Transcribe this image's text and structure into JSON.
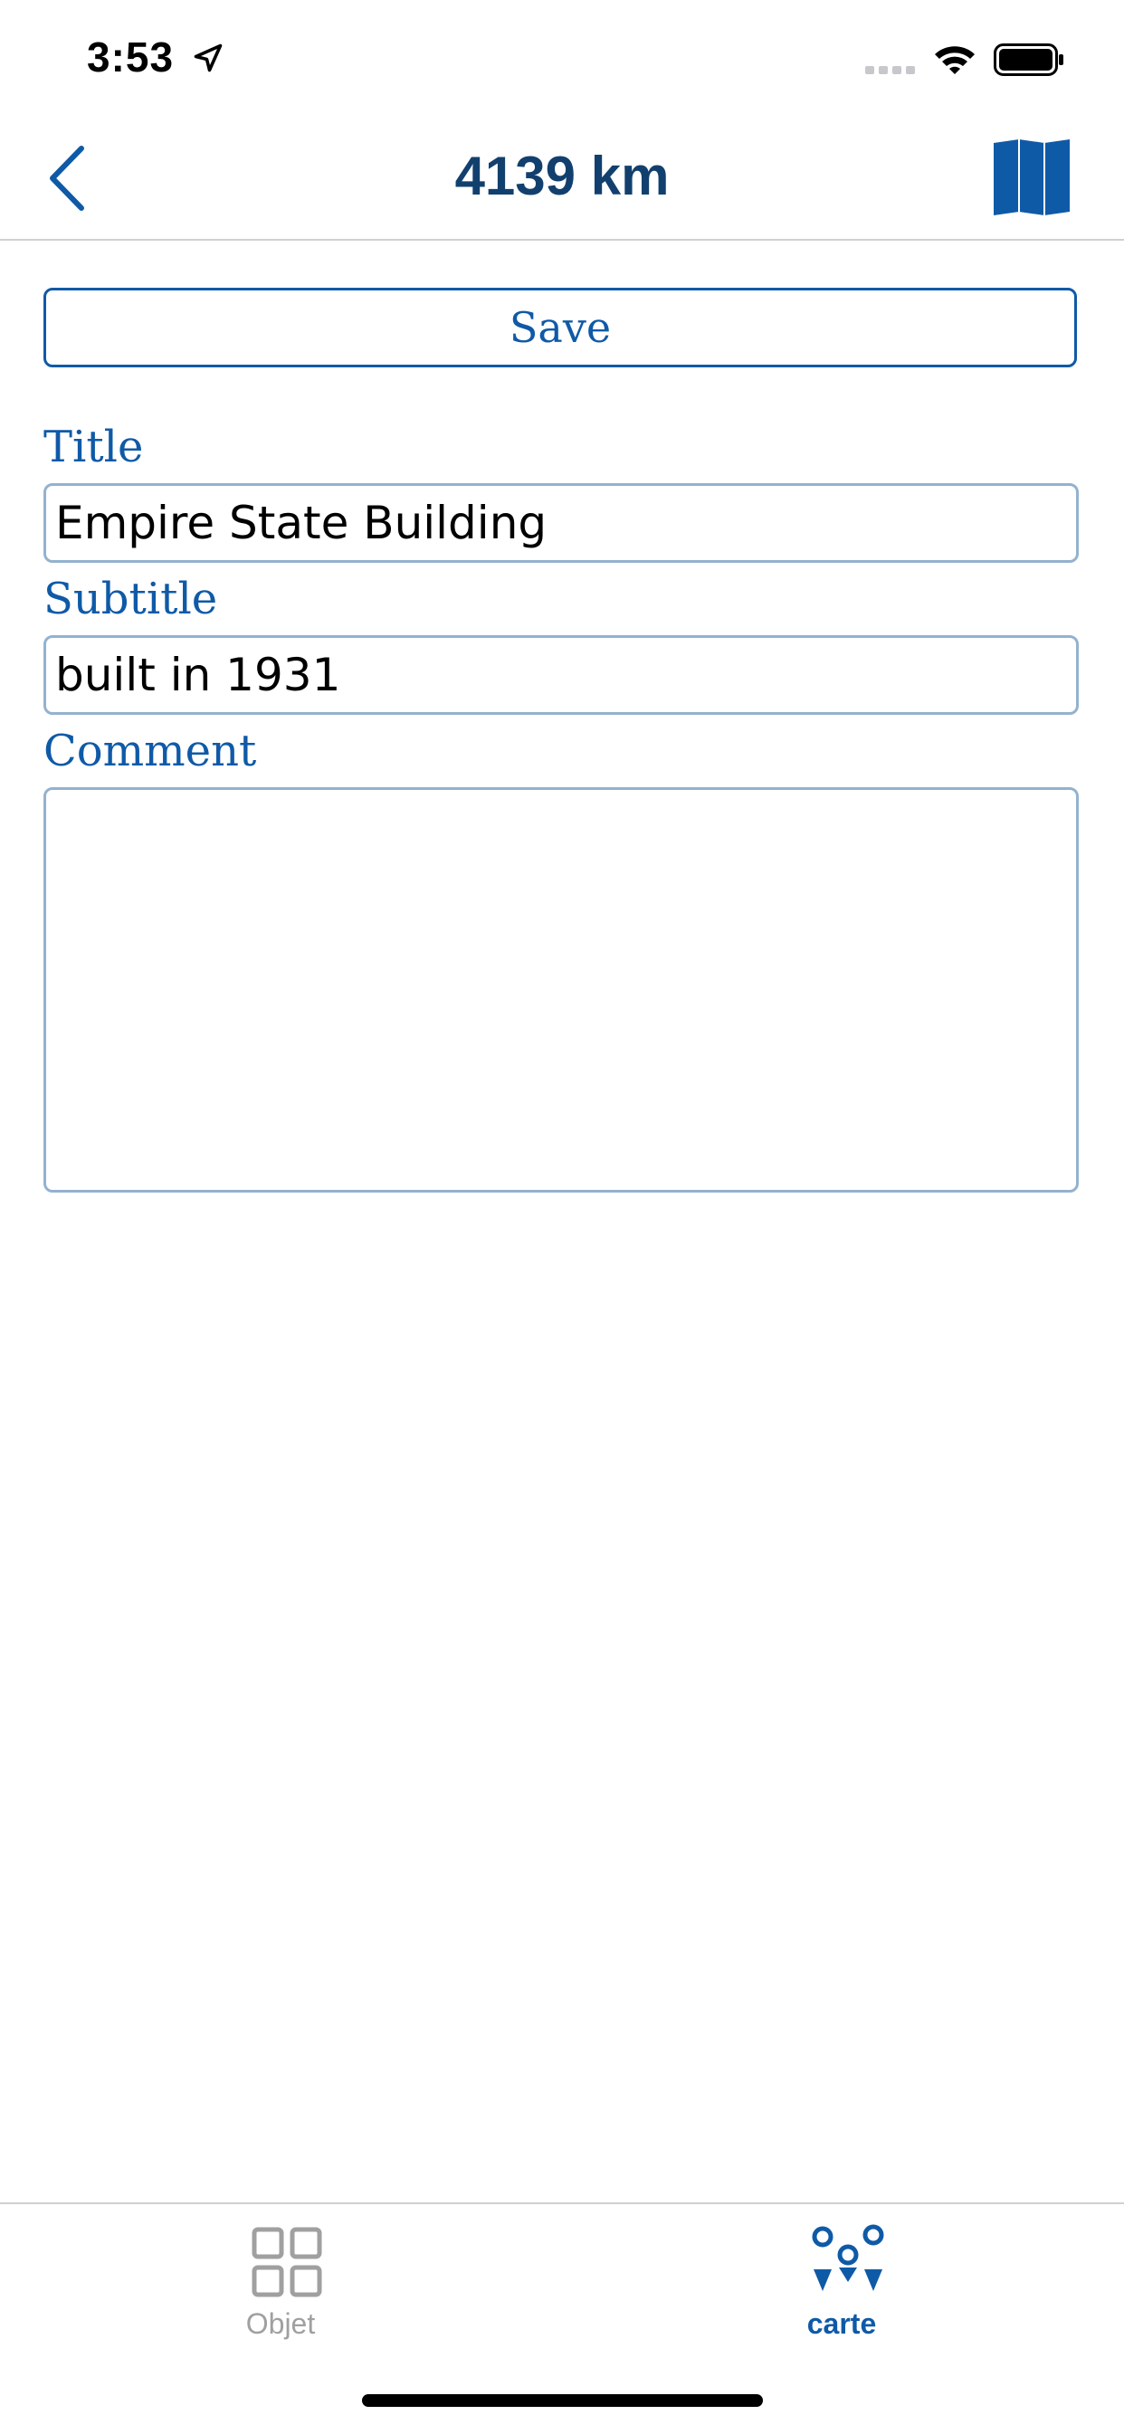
{
  "status_bar": {
    "time": "3:53"
  },
  "nav": {
    "title": "4139 km"
  },
  "form": {
    "save_label": "Save",
    "title_label": "Title",
    "title_value": "Empire State Building",
    "subtitle_label": "Subtitle",
    "subtitle_value": "built in 1931",
    "comment_label": "Comment",
    "comment_value": ""
  },
  "tab_bar": {
    "tabs": [
      {
        "label": "Objet",
        "icon": "grid-icon",
        "selected": false
      },
      {
        "label": "carte",
        "icon": "map-pins-icon",
        "selected": true
      }
    ]
  },
  "colors": {
    "accent": "#0f5aa7",
    "title": "#12406e",
    "field_border": "#93b2cf",
    "inactive_tab": "#a0a0a0"
  }
}
